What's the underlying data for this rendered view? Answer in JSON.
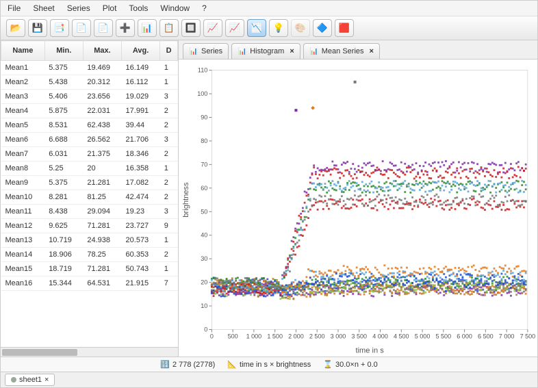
{
  "menu": [
    "File",
    "Sheet",
    "Series",
    "Plot",
    "Tools",
    "Window",
    "?"
  ],
  "toolbar_icons": [
    "open-icon",
    "save-icon",
    "add-sheet-icon",
    "sheet-icon",
    "sheet2-icon",
    "add-series-icon",
    "series-icon",
    "copy-series-icon",
    "plot-toggle-icon",
    "chart-icon",
    "chart-add-icon",
    "mean-series-icon",
    "highlight-icon",
    "color-icon",
    "collapse-icon",
    "expand-icon"
  ],
  "toolbar_glyphs": [
    "📂",
    "💾",
    "📑",
    "📄",
    "📄",
    "➕",
    "📊",
    "📋",
    "🔲",
    "📈",
    "📈",
    "📉",
    "💡",
    "🎨",
    "🔷",
    "🟥"
  ],
  "toolbar_active_index": 11,
  "table": {
    "columns": [
      "Name",
      "Min.",
      "Max.",
      "Avg.",
      "D"
    ],
    "rows": [
      [
        "Mean1",
        "5.375",
        "19.469",
        "16.149",
        "1"
      ],
      [
        "Mean2",
        "5.438",
        "20.312",
        "16.112",
        "1"
      ],
      [
        "Mean3",
        "5.406",
        "23.656",
        "19.029",
        "3"
      ],
      [
        "Mean4",
        "5.875",
        "22.031",
        "17.991",
        "2"
      ],
      [
        "Mean5",
        "8.531",
        "62.438",
        "39.44",
        "2"
      ],
      [
        "Mean6",
        "6.688",
        "26.562",
        "21.706",
        "3"
      ],
      [
        "Mean7",
        "6.031",
        "21.375",
        "18.346",
        "2"
      ],
      [
        "Mean8",
        "5.25",
        "20",
        "16.358",
        "1"
      ],
      [
        "Mean9",
        "5.375",
        "21.281",
        "17.082",
        "2"
      ],
      [
        "Mean10",
        "8.281",
        "81.25",
        "42.474",
        "2"
      ],
      [
        "Mean11",
        "8.438",
        "29.094",
        "19.23",
        "3"
      ],
      [
        "Mean12",
        "9.625",
        "71.281",
        "23.727",
        "9"
      ],
      [
        "Mean13",
        "10.719",
        "24.938",
        "20.573",
        "1"
      ],
      [
        "Mean14",
        "18.906",
        "78.25",
        "60.353",
        "2"
      ],
      [
        "Mean15",
        "18.719",
        "71.281",
        "50.743",
        "1"
      ],
      [
        "Mean16",
        "15.344",
        "64.531",
        "21.915",
        "7"
      ]
    ]
  },
  "tabs": [
    {
      "label": "Series",
      "closable": false,
      "icon": "series-tab-icon"
    },
    {
      "label": "Histogram",
      "closable": true,
      "icon": "histogram-tab-icon"
    },
    {
      "label": "Mean Series",
      "closable": true,
      "icon": "mean-series-tab-icon"
    }
  ],
  "status": {
    "count": "2 778 (2778)",
    "axes": "time in s × brightness",
    "formula": "30.0×n + 0.0"
  },
  "sheet_tab": "sheet1",
  "chart_data": {
    "type": "scatter",
    "xlabel": "time in s",
    "ylabel": "brightness",
    "xlim": [
      0,
      7500
    ],
    "ylim": [
      0,
      110
    ],
    "xticks": [
      0,
      500,
      1000,
      1500,
      2000,
      2500,
      3000,
      3500,
      4000,
      4500,
      5000,
      5500,
      6000,
      6500,
      7000,
      7500
    ],
    "yticks": [
      0,
      10,
      20,
      30,
      40,
      50,
      60,
      70,
      80,
      90,
      100,
      110
    ],
    "note": "Many overlapping series (≈16) rising from ~15-20 before t≈1700s to plateaus between 20 and 80 after. Series-level min/max/avg summarized in table.rows.",
    "series_colors": [
      "#7b2ea8",
      "#e67817",
      "#2a8a2a",
      "#1f4fd1",
      "#c81c1c",
      "#5aa3d8",
      "#777777",
      "#b37a2e",
      "#8bc34a",
      "#7b2ea8",
      "#e67817",
      "#2a8a2a",
      "#1f4fd1",
      "#c81c1c",
      "#5aa3d8",
      "#777777"
    ]
  }
}
